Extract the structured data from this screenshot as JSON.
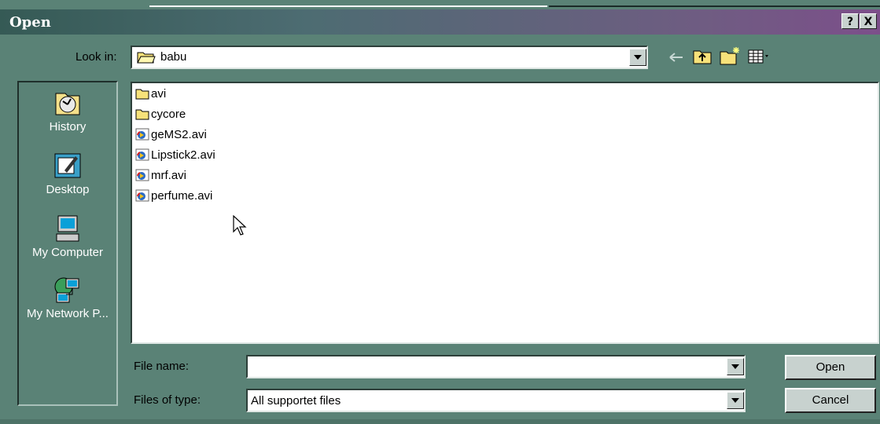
{
  "window": {
    "title": "Open",
    "help_label": "?",
    "close_label": "X"
  },
  "look_in": {
    "label": "Look in:",
    "value": "babu"
  },
  "toolbar": {
    "icons": [
      "back-arrow-icon",
      "up-folder-icon",
      "new-folder-icon",
      "view-menu-icon"
    ]
  },
  "places": [
    {
      "label": "History",
      "icon": "history-icon"
    },
    {
      "label": "Desktop",
      "icon": "desktop-icon"
    },
    {
      "label": "My Computer",
      "icon": "my-computer-icon"
    },
    {
      "label": "My Network P...",
      "icon": "network-places-icon"
    }
  ],
  "files": [
    {
      "name": "avi",
      "type": "folder"
    },
    {
      "name": "cycore",
      "type": "folder"
    },
    {
      "name": "geMS2.avi",
      "type": "video"
    },
    {
      "name": "Lipstick2.avi",
      "type": "video"
    },
    {
      "name": "mrf.avi",
      "type": "video"
    },
    {
      "name": "perfume.avi",
      "type": "video"
    }
  ],
  "file_name": {
    "label": "File name:",
    "value": ""
  },
  "files_of_type": {
    "label": "Files of type:",
    "value": "All supportet files"
  },
  "buttons": {
    "open": "Open",
    "cancel": "Cancel"
  },
  "colors": {
    "dialog_bg": "#5a8276",
    "title_start": "#355a55",
    "title_end": "#7c4f8a"
  }
}
